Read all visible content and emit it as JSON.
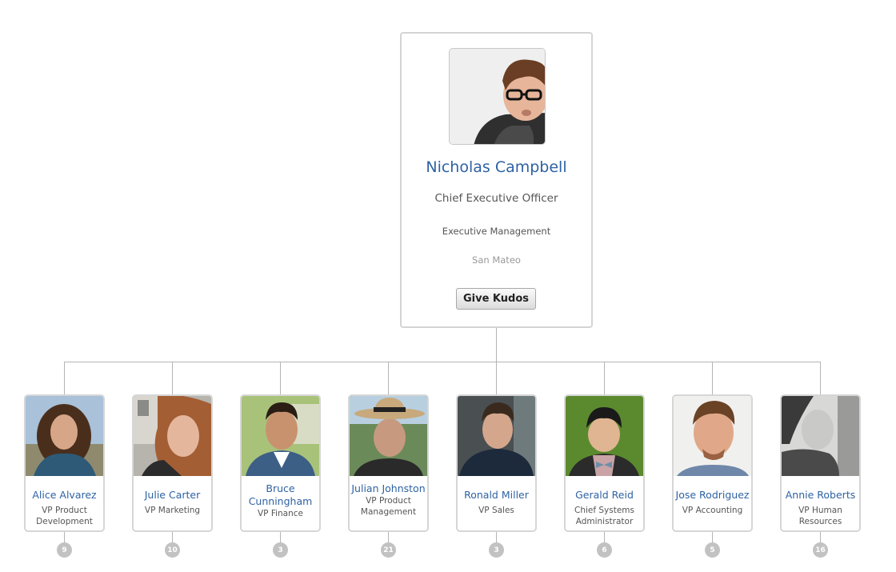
{
  "root": {
    "name": "Nicholas Campbell",
    "title": "Chief Executive Officer",
    "department": "Executive Management",
    "location": "San Mateo",
    "button_label": "Give Kudos",
    "photo_icon": "person-photo"
  },
  "children": [
    {
      "name": "Alice Alvarez",
      "title": "VP Product Development",
      "reports": "9",
      "photo_icon": "person-photo"
    },
    {
      "name": "Julie Carter",
      "title": "VP Marketing",
      "reports": "10",
      "photo_icon": "person-photo"
    },
    {
      "name": "Bruce Cunningham",
      "title": "VP Finance",
      "reports": "3",
      "photo_icon": "person-photo"
    },
    {
      "name": "Julian Johnston",
      "title": "VP Product Management",
      "reports": "21",
      "photo_icon": "person-photo"
    },
    {
      "name": "Ronald Miller",
      "title": "VP Sales",
      "reports": "3",
      "photo_icon": "person-photo"
    },
    {
      "name": "Gerald Reid",
      "title": "Chief Systems Administrator",
      "reports": "6",
      "photo_icon": "person-photo"
    },
    {
      "name": "Jose Rodriguez",
      "title": "VP Accounting",
      "reports": "5",
      "photo_icon": "person-photo"
    },
    {
      "name": "Annie Roberts",
      "title": "VP Human Resources",
      "reports": "16",
      "photo_icon": "person-photo"
    }
  ],
  "colors": {
    "name_link": "#2e62a3",
    "connector": "#b4b4b4",
    "badge": "#c2c2c2"
  }
}
